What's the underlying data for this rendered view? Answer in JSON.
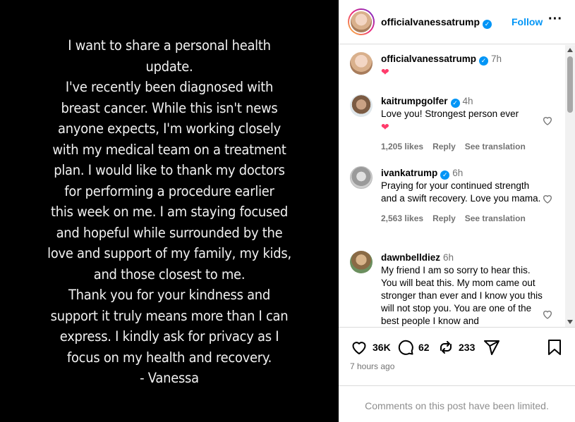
{
  "post": {
    "lines": [
      "I want to share a personal health",
      "update.",
      "I've recently been diagnosed with",
      "breast cancer. While this isn't news",
      "anyone expects, I'm working closely",
      "with my medical team on a treatment",
      "plan. I would like to thank my doctors",
      "for performing a procedure earlier",
      "this week on me. I am staying focused",
      "and hopeful while surrounded by the",
      "love and support of my family, my kids,",
      "and those closest to me.",
      "Thank you for your kindness and",
      "support it truly means more than I can",
      "express. I kindly ask for privacy as I",
      "focus on my health and recovery.",
      "- Vanessa"
    ]
  },
  "header": {
    "username": "officialvanessatrump",
    "follow_label": "Follow",
    "more_label": "···"
  },
  "comments": [
    {
      "user": "officialvanessatrump",
      "time": "7h",
      "text": "❤",
      "likes": "",
      "reply": "",
      "translate": ""
    },
    {
      "user": "kaitrumpgolfer",
      "time": "4h",
      "text": "Love you! Strongest person ever",
      "text2": "❤",
      "likes": "1,205 likes",
      "reply": "Reply",
      "translate": "See translation"
    },
    {
      "user": "ivankatrump",
      "time": "6h",
      "text": "Praying for your continued strength and a swift recovery. Love you mama.",
      "likes": "2,563 likes",
      "reply": "Reply",
      "translate": "See translation"
    },
    {
      "user": "dawnbelldiez",
      "time": "6h",
      "text": "My friend I am so sorry to hear this. You will beat this. My mom came out stronger than ever and I know you this will not stop you. You are one of the best people I know and"
    }
  ],
  "actions": {
    "likes": "36K",
    "comments": "62",
    "reposts": "233",
    "posted": "7 hours ago"
  },
  "footer": {
    "limited": "Comments on this post have been limited."
  },
  "colors": {
    "accent": "#0095f6",
    "heart": "#ff3b6b",
    "muted": "#737373"
  }
}
